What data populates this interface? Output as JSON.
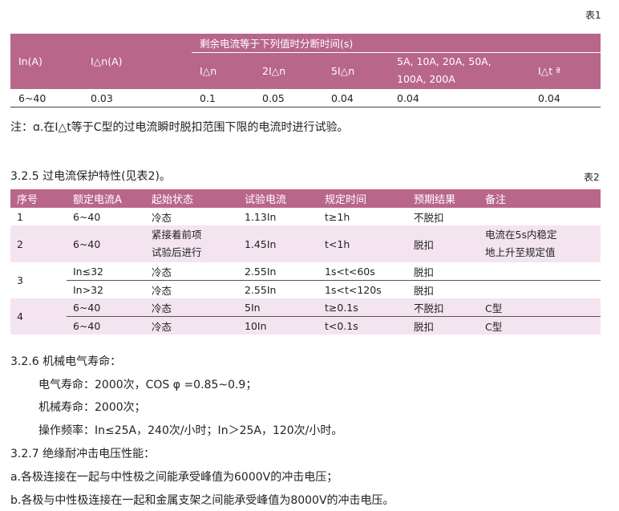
{
  "table1": {
    "label": "表1",
    "headers": {
      "in": "In(A)",
      "idn": "I△n(A)",
      "group": "剩余电流等于下列值时分断时间(s)",
      "c1": "I△n",
      "c2": "2I△n",
      "c3": "5I△n",
      "c4a": "5A, 10A, 20A, 50A,",
      "c4b": "100A, 200A",
      "c5": "I△t ª"
    },
    "row": [
      "6~40",
      "0.03",
      "0.1",
      "0.05",
      "0.04",
      "0.04",
      "0.04"
    ]
  },
  "note": "注：ɑ.在I△t等于C型的过电流瞬时脱扣范围下限的电流时进行试验。",
  "section_325": "3.2.5 过电流保护特性(见表2)。",
  "table2": {
    "label": "表2",
    "headers": [
      "序号",
      "额定电流A",
      "起始状态",
      "试验电流",
      "规定时间",
      "预期结果",
      "备注"
    ],
    "rows": {
      "r1": [
        "1",
        "6~40",
        "冷态",
        "1.13In",
        "t≥1h",
        "不脱扣",
        ""
      ],
      "r2": [
        "2",
        "6~40",
        "紧接着前项",
        "试验后进行",
        "1.45In",
        "t<1h",
        "脱扣",
        "电流在5s内稳定",
        "地上升至规定值"
      ],
      "r3a": [
        "3",
        "In≤32",
        "冷态",
        "2.55In",
        "1s<t<60s",
        "脱扣"
      ],
      "r3b": [
        "In>32",
        "冷态",
        "2.55In",
        "1s<t<120s",
        "脱扣"
      ],
      "r4a": [
        "4",
        "6~40",
        "冷态",
        "5In",
        "t≥0.1s",
        "不脱扣",
        "C型"
      ],
      "r4b": [
        "6~40",
        "冷态",
        "10In",
        "t<0.1s",
        "脱扣",
        "C型"
      ]
    }
  },
  "section_326": {
    "title": "3.2.6 机械电气寿命：",
    "l1": "电气寿命：2000次，COS φ =0.85~0.9；",
    "l2": "机械寿命：2000次；",
    "l3": "操作频率：In≤25A，240次/小时；In＞25A，120次/小时。"
  },
  "section_327": {
    "title": "3.2.7 绝缘耐冲击电压性能：",
    "a": "a.各极连接在一起与中性极之间能承受峰值为6000V的冲击电压；",
    "b": "b.各极与中性极连接在一起和金属支架之间能承受峰值为8000V的冲击电压。"
  }
}
